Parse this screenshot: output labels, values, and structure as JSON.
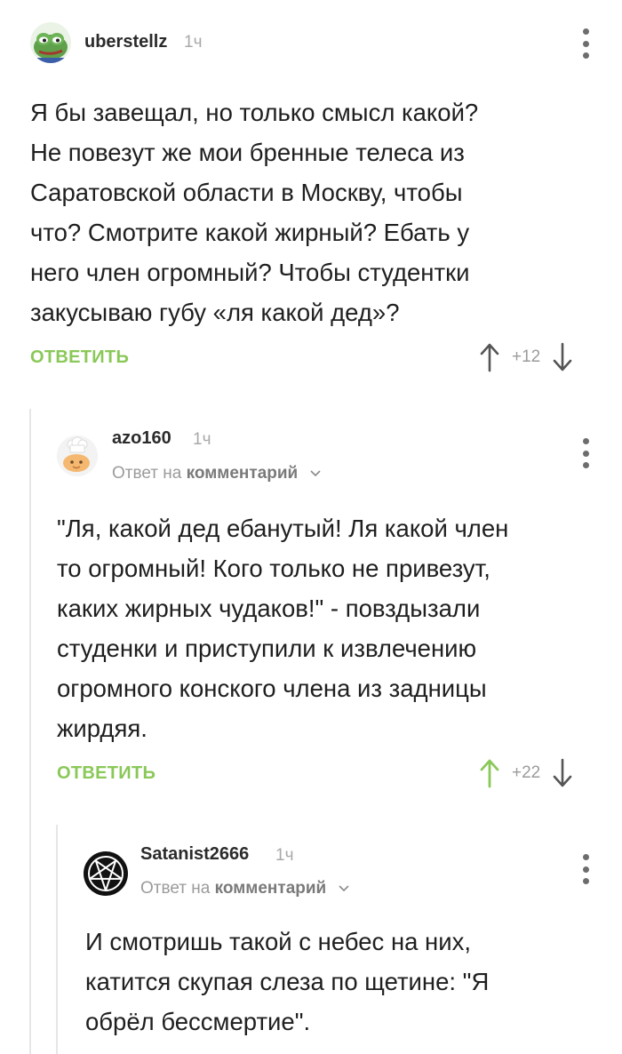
{
  "comments": [
    {
      "username": "uberstellz",
      "time": "1ч",
      "avatar_icon": "pepe-frog-avatar",
      "text_lines": [
        "Я бы завещал, но только смысл какой?",
        "Не повезут же мои бренные телеса из",
        "Саратовской области в Москву, чтобы",
        "что? Смотрите какой жирный? Ебать у",
        "него член огромный? Чтобы студентки",
        "закусываю губу «ля какой дед»?"
      ],
      "reply_label": "ОТВЕТИТЬ",
      "score": "+12",
      "upvoted": false
    },
    {
      "username": "azo160",
      "time": "1ч",
      "avatar_icon": "cook-avatar",
      "reply_to_prefix": "Ответ на",
      "reply_to_target": "комментарий",
      "text_lines": [
        "\"Ля, какой дед ебанутый! Ля какой член",
        "то огромный! Кого только не привезут,",
        "каких жирных чудаков!\" - повздызали",
        "студенки и приступили к извлечению",
        "огромного конского члена из задницы",
        "жирдяя."
      ],
      "reply_label": "ОТВЕТИТЬ",
      "score": "+22",
      "upvoted": true
    },
    {
      "username": "Satanist2666",
      "time": "1ч",
      "avatar_icon": "pentagram-avatar",
      "reply_to_prefix": "Ответ на",
      "reply_to_target": "комментарий",
      "text_lines": [
        "И смотришь такой с небес на них,",
        "катится скупая слеза по щетине: \"Я",
        "обрёл бессмертие\"."
      ]
    }
  ],
  "colors": {
    "accent_green": "#8ac858",
    "thread_line": "#e6e6e6",
    "muted_text": "#9b9b9b"
  }
}
